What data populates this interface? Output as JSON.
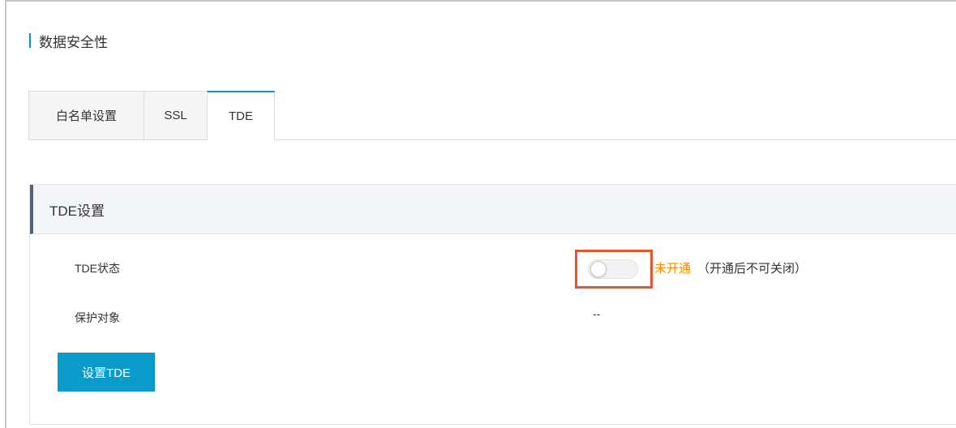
{
  "page": {
    "title": "数据安全性"
  },
  "tabs": [
    {
      "label": "白名单设置",
      "active": false
    },
    {
      "label": "SSL",
      "active": false
    },
    {
      "label": "TDE",
      "active": true
    }
  ],
  "panel": {
    "title": "TDE设置",
    "status_label": "TDE状态",
    "status_value": "未开通",
    "status_note": "（开通后不可关闭）",
    "switch_on": false,
    "target_label": "保护对象",
    "target_value": "--",
    "button_label": "设置TDE"
  },
  "colors": {
    "accent": "#0099cc",
    "button": "#0a9bcb",
    "status_off": "#ff8a00",
    "highlight": "#e5532f"
  }
}
